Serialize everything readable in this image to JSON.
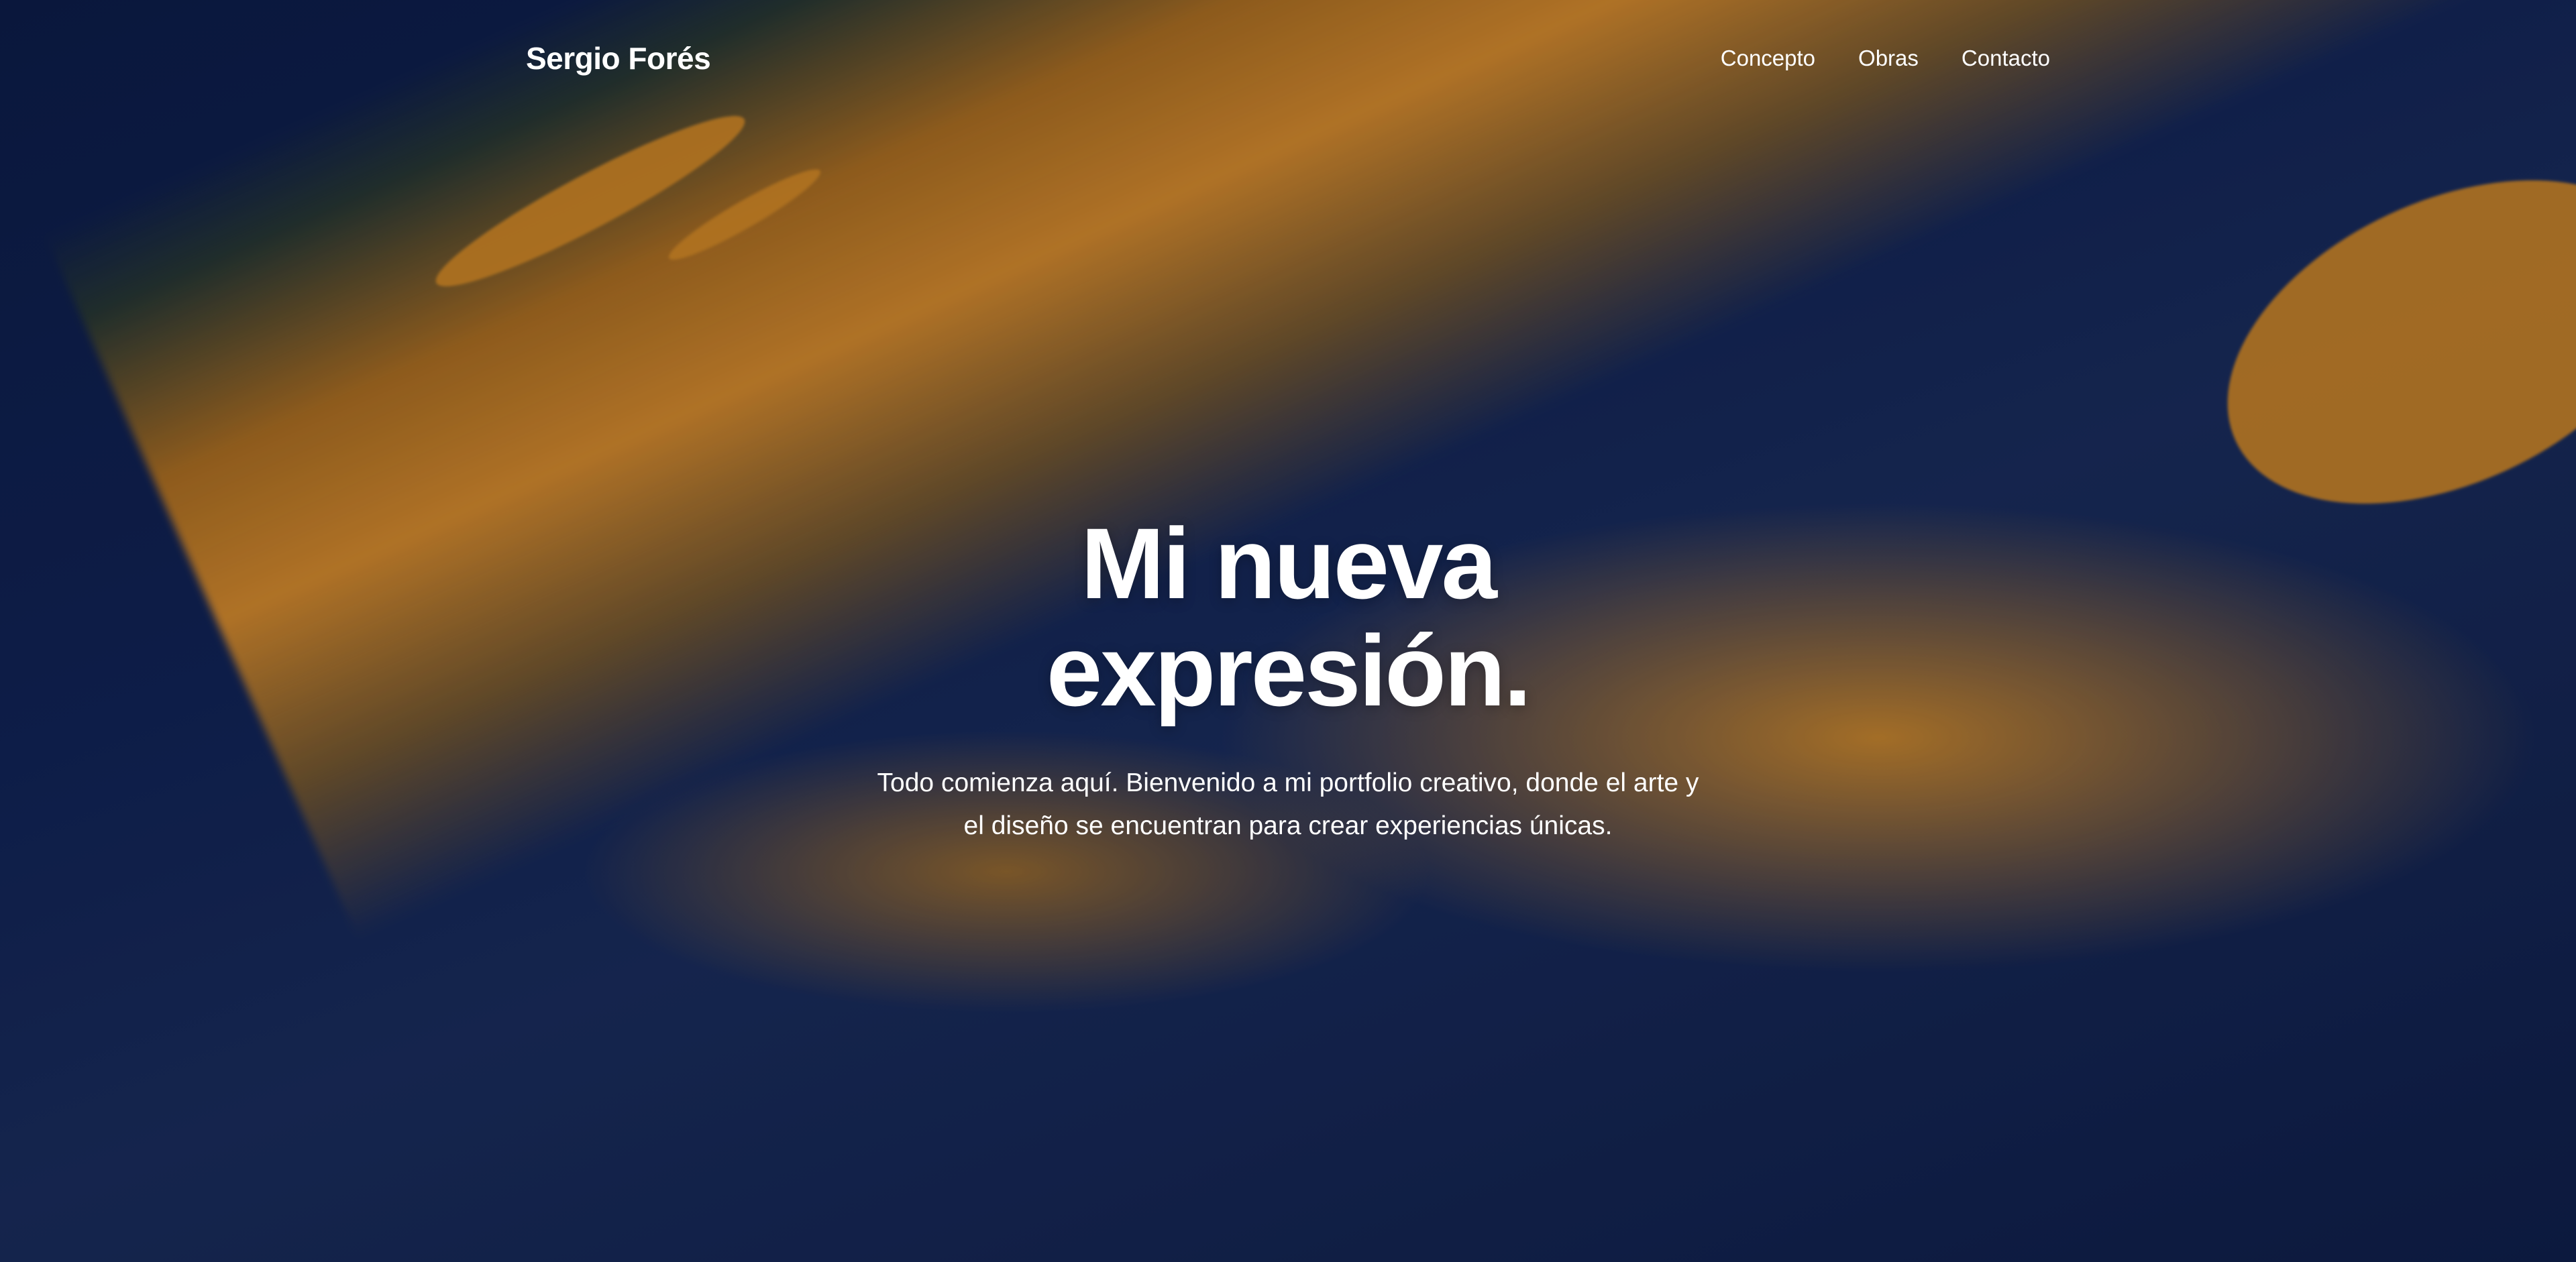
{
  "brand": {
    "name": "Sergio Forés"
  },
  "nav": {
    "items": [
      {
        "label": "Concepto"
      },
      {
        "label": "Obras"
      },
      {
        "label": "Contacto"
      }
    ]
  },
  "hero": {
    "title_line1": "Mi nueva",
    "title_line2": "expresión.",
    "subtitle": "Todo comienza aquí. Bienvenido a mi portfolio creativo, donde el arte y el diseño se encuentran para crear experiencias únicas."
  },
  "colors": {
    "background_blue": "#112458",
    "paint_orange": "#e1912d",
    "text": "#ffffff"
  }
}
